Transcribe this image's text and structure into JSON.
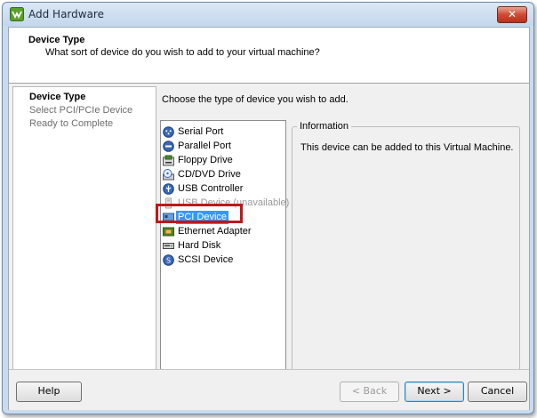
{
  "window": {
    "title": "Add Hardware",
    "close_glyph": "✕"
  },
  "header": {
    "title": "Device Type",
    "subtitle": "What sort of device do you wish to add to your virtual machine?"
  },
  "steps": [
    {
      "label": "Device Type",
      "state": "active"
    },
    {
      "label": "Select PCI/PCIe Device",
      "state": "pending"
    },
    {
      "label": "Ready to Complete",
      "state": "pending"
    }
  ],
  "main": {
    "prompt": "Choose the type of device you wish to add.",
    "devices": [
      {
        "label": "Serial Port",
        "icon": "serial-port-icon",
        "state": "normal"
      },
      {
        "label": "Parallel Port",
        "icon": "parallel-port-icon",
        "state": "normal"
      },
      {
        "label": "Floppy Drive",
        "icon": "floppy-drive-icon",
        "state": "normal"
      },
      {
        "label": "CD/DVD Drive",
        "icon": "cd-dvd-drive-icon",
        "state": "normal"
      },
      {
        "label": "USB Controller",
        "icon": "usb-controller-icon",
        "state": "normal"
      },
      {
        "label": "USB Device (unavailable)",
        "icon": "usb-device-icon",
        "state": "disabled"
      },
      {
        "label": "PCI Device",
        "icon": "pci-device-icon",
        "state": "selected"
      },
      {
        "label": "Ethernet Adapter",
        "icon": "ethernet-adapter-icon",
        "state": "normal"
      },
      {
        "label": "Hard Disk",
        "icon": "hard-disk-icon",
        "state": "normal"
      },
      {
        "label": "SCSI Device",
        "icon": "scsi-device-icon",
        "state": "normal"
      }
    ],
    "information": {
      "legend": "Information",
      "text": "This device can be added to this Virtual Machine."
    }
  },
  "footer": {
    "help": "Help",
    "back": "< Back",
    "next": "Next >",
    "cancel": "Cancel"
  },
  "colors": {
    "selection": "#3399ff",
    "highlight_box": "#c0171a",
    "window_frame": "#c9dcee"
  }
}
